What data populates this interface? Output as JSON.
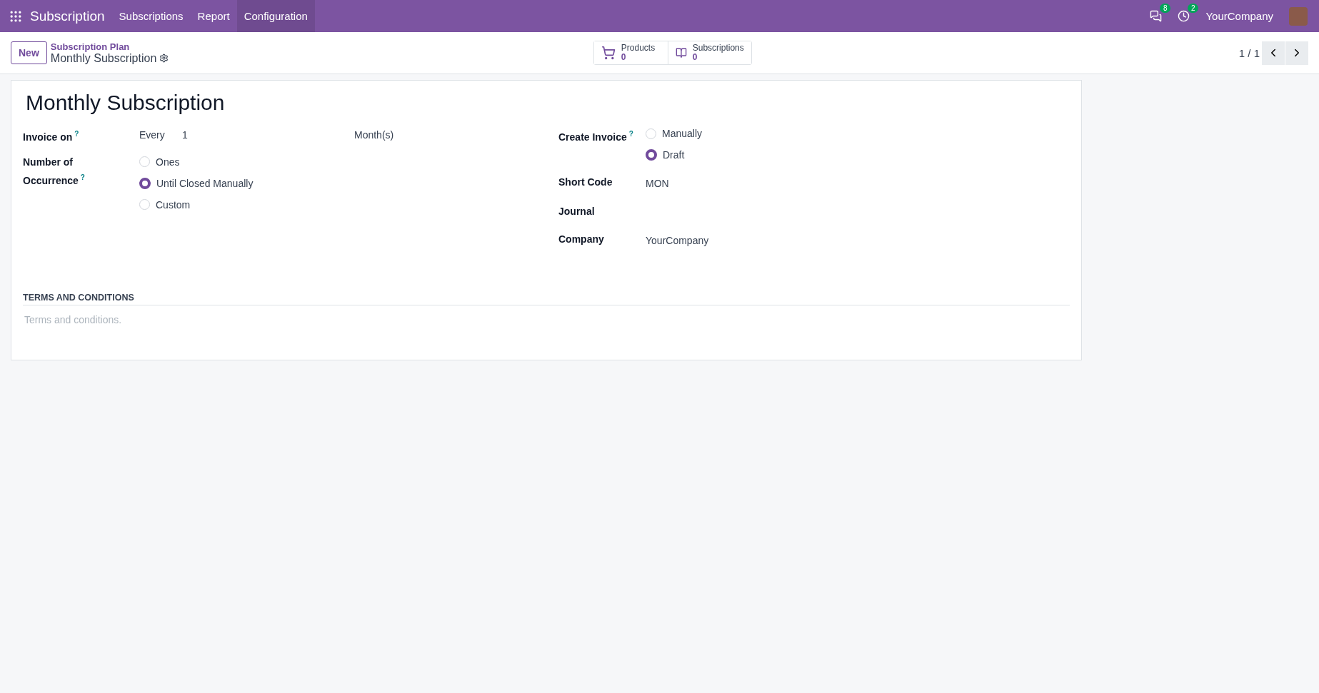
{
  "navbar": {
    "app_name": "Subscription",
    "menu": [
      {
        "label": "Subscriptions",
        "selected": false
      },
      {
        "label": "Report",
        "selected": false
      },
      {
        "label": "Configuration",
        "selected": true
      }
    ],
    "messages_count": "8",
    "activities_count": "2",
    "company": "YourCompany"
  },
  "control_panel": {
    "new_button": "New",
    "breadcrumb": "Subscription Plan",
    "record_name": "Monthly Subscription",
    "smart_buttons": [
      {
        "kind": "cart",
        "label": "Products",
        "value": "0"
      },
      {
        "kind": "book",
        "label": "Subscriptions",
        "value": "0"
      }
    ],
    "pager": "1 / 1"
  },
  "form": {
    "title": "Monthly Subscription",
    "invoice_on": {
      "label": "Invoice on",
      "help": "?",
      "every": "Every",
      "interval": "1",
      "unit": "Month(s)"
    },
    "occurrence": {
      "label": "Number of Occurrence",
      "help": "?",
      "options": [
        {
          "label": "Ones",
          "selected": false
        },
        {
          "label": "Until Closed Manually",
          "selected": true
        },
        {
          "label": "Custom",
          "selected": false
        }
      ]
    },
    "create_invoice": {
      "label": "Create Invoice",
      "help": "?",
      "options": [
        {
          "label": "Manually",
          "selected": false
        },
        {
          "label": "Draft",
          "selected": true
        }
      ]
    },
    "fields": [
      {
        "label": "Short Code",
        "value": "MON"
      },
      {
        "label": "Journal"
      },
      {
        "label": "Company",
        "value": "YourCompany"
      }
    ],
    "terms": {
      "heading": "TERMS AND CONDITIONS",
      "placeholder": "Terms and conditions."
    }
  }
}
